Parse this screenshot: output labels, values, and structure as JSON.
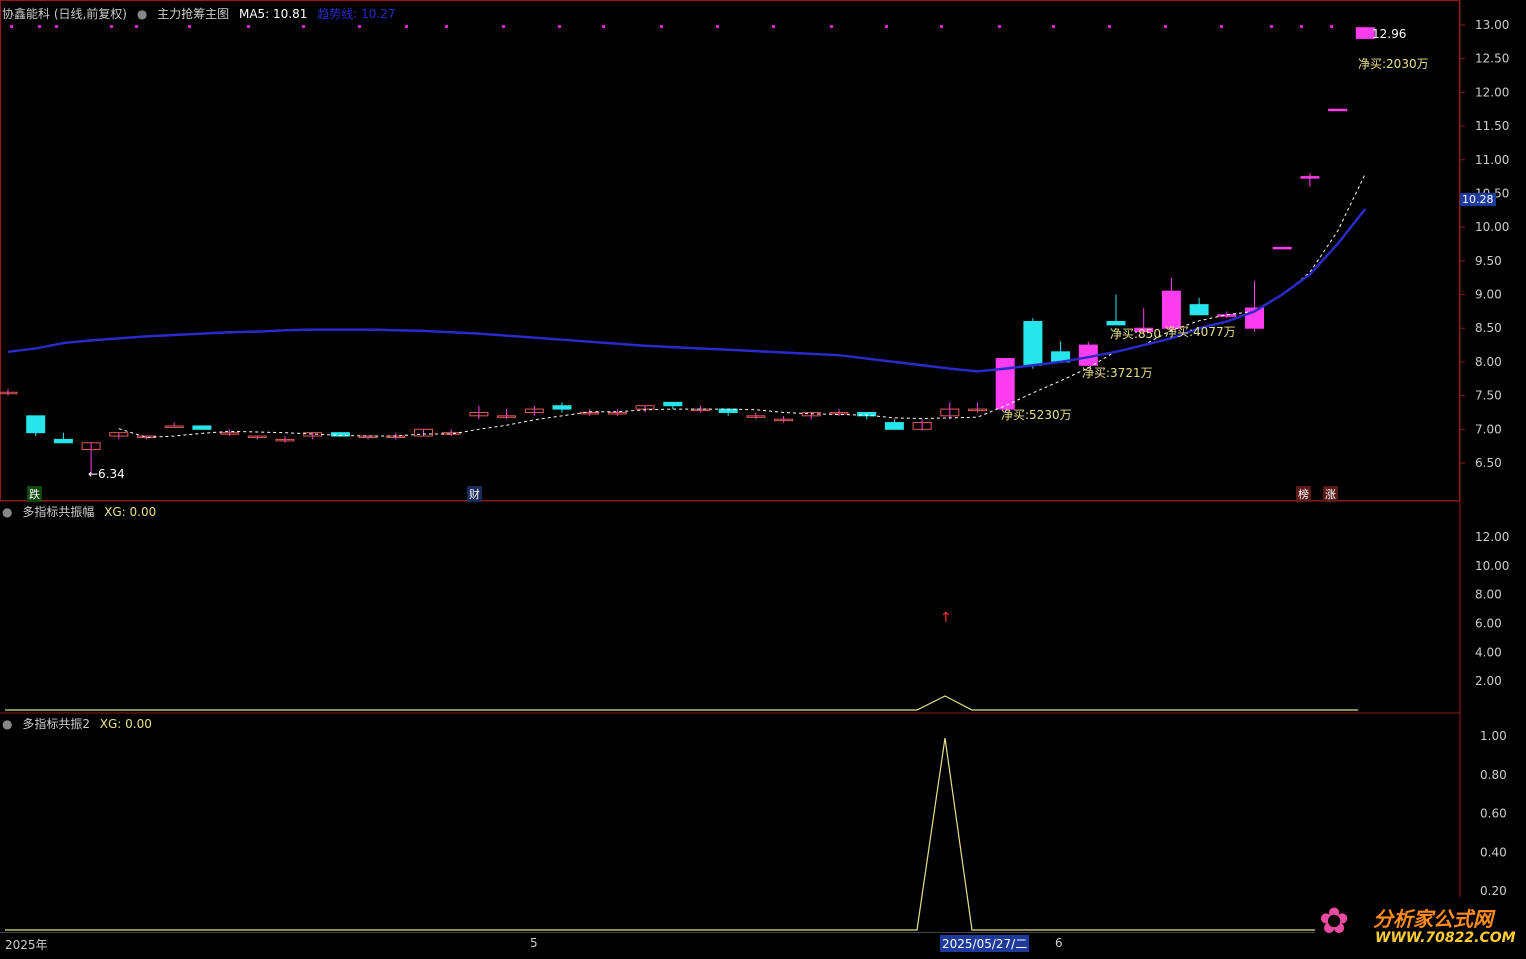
{
  "main_header": {
    "stock": "协鑫能科 (日线,前复权)",
    "indicator": "主力抢筹主图",
    "ma5": "MA5: 10.81",
    "trend": "趋势线: 10.27"
  },
  "sub1_header": {
    "name": "多指标共振幅",
    "xg": "XG: 0.00"
  },
  "sub2_header": {
    "name": "多指标共振2",
    "xg": "XG: 0.00"
  },
  "price_axis": [
    "13.00",
    "12.50",
    "12.00",
    "11.50",
    "11.00",
    "10.50",
    "10.00",
    "9.50",
    "9.00",
    "8.50",
    "8.00",
    "7.50",
    "7.00",
    "6.50"
  ],
  "current_price_tag": "10.28",
  "sub1_axis": [
    "12.00",
    "10.00",
    "8.00",
    "6.00",
    "4.00",
    "2.00"
  ],
  "sub2_axis": [
    "1.00",
    "0.80",
    "0.60",
    "0.40",
    "0.20"
  ],
  "annotations": {
    "high": "12.96",
    "low": "←6.34",
    "net_buy_1": "净买:5230万",
    "net_buy_2": "净买:3721万",
    "net_buy_3": "净买:850",
    "net_buy_4": "净买:4077万",
    "net_buy_5": "净买:2030万"
  },
  "event_tags": {
    "t1": "跌",
    "t2": "财",
    "t3": "榜",
    "t4": "涨"
  },
  "time_axis": {
    "year": "2025年",
    "m5": "5",
    "cursor": "2025/05/27/二",
    "m6": "6"
  },
  "logo": {
    "name": "分析家公式网",
    "url": "WWW.70822.COM"
  },
  "colors": {
    "up": "#ff3df0",
    "down": "#26e6ec",
    "ma5": "#ffffff",
    "trend": "#2a2ac8",
    "signal": "#e8e08a",
    "grid": "#8b1a1a"
  },
  "chart_data": {
    "type": "candlestick",
    "candles": [
      [
        7.55,
        7.6,
        7.5,
        7.55
      ],
      [
        7.2,
        7.2,
        6.9,
        6.95
      ],
      [
        6.85,
        6.95,
        6.8,
        6.8
      ],
      [
        6.7,
        6.8,
        6.34,
        6.8
      ],
      [
        6.9,
        6.95,
        6.85,
        6.95
      ],
      [
        6.9,
        6.9,
        6.85,
        6.9
      ],
      [
        7.05,
        7.1,
        7.05,
        7.05
      ],
      [
        7.05,
        7.05,
        7.0,
        7.0
      ],
      [
        6.95,
        7.0,
        6.9,
        6.95
      ],
      [
        6.9,
        6.9,
        6.85,
        6.9
      ],
      [
        6.85,
        6.9,
        6.8,
        6.85
      ],
      [
        6.9,
        6.95,
        6.85,
        6.95
      ],
      [
        6.95,
        6.95,
        6.9,
        6.9
      ],
      [
        6.9,
        6.9,
        6.85,
        6.9
      ],
      [
        6.9,
        6.95,
        6.85,
        6.9
      ],
      [
        6.9,
        7.0,
        6.9,
        7.0
      ],
      [
        6.95,
        7.0,
        6.9,
        6.95
      ],
      [
        7.2,
        7.35,
        7.15,
        7.25
      ],
      [
        7.2,
        7.3,
        7.15,
        7.2
      ],
      [
        7.25,
        7.35,
        7.2,
        7.3
      ],
      [
        7.35,
        7.4,
        7.25,
        7.3
      ],
      [
        7.25,
        7.3,
        7.2,
        7.25
      ],
      [
        7.25,
        7.3,
        7.2,
        7.25
      ],
      [
        7.3,
        7.35,
        7.25,
        7.35
      ],
      [
        7.4,
        7.4,
        7.3,
        7.35
      ],
      [
        7.3,
        7.35,
        7.25,
        7.3
      ],
      [
        7.3,
        7.3,
        7.2,
        7.25
      ],
      [
        7.2,
        7.25,
        7.15,
        7.2
      ],
      [
        7.15,
        7.2,
        7.1,
        7.15
      ],
      [
        7.2,
        7.25,
        7.15,
        7.25
      ],
      [
        7.25,
        7.3,
        7.2,
        7.25
      ],
      [
        7.25,
        7.25,
        7.15,
        7.2
      ],
      [
        7.1,
        7.15,
        7.0,
        7.0
      ],
      [
        7.0,
        7.15,
        6.98,
        7.1
      ],
      [
        7.2,
        7.4,
        7.15,
        7.3
      ],
      [
        7.3,
        7.4,
        7.25,
        7.3
      ],
      [
        7.3,
        8.05,
        7.25,
        8.05
      ],
      [
        8.6,
        8.65,
        7.9,
        7.95
      ],
      [
        8.15,
        8.3,
        8.0,
        8.0
      ],
      [
        7.95,
        8.3,
        7.95,
        8.25
      ],
      [
        8.6,
        9.0,
        8.55,
        8.55
      ],
      [
        8.45,
        8.8,
        8.4,
        8.5
      ],
      [
        8.5,
        9.25,
        8.45,
        9.05
      ],
      [
        8.85,
        8.95,
        8.7,
        8.7
      ],
      [
        8.7,
        8.75,
        8.65,
        8.7
      ],
      [
        8.5,
        9.2,
        8.45,
        8.8
      ],
      [
        9.7,
        9.7,
        9.7,
        9.7
      ],
      [
        10.75,
        10.8,
        10.6,
        10.75
      ],
      [
        11.75,
        11.75,
        11.75,
        11.75
      ],
      [
        12.8,
        12.96,
        12.8,
        12.96
      ]
    ]
  }
}
